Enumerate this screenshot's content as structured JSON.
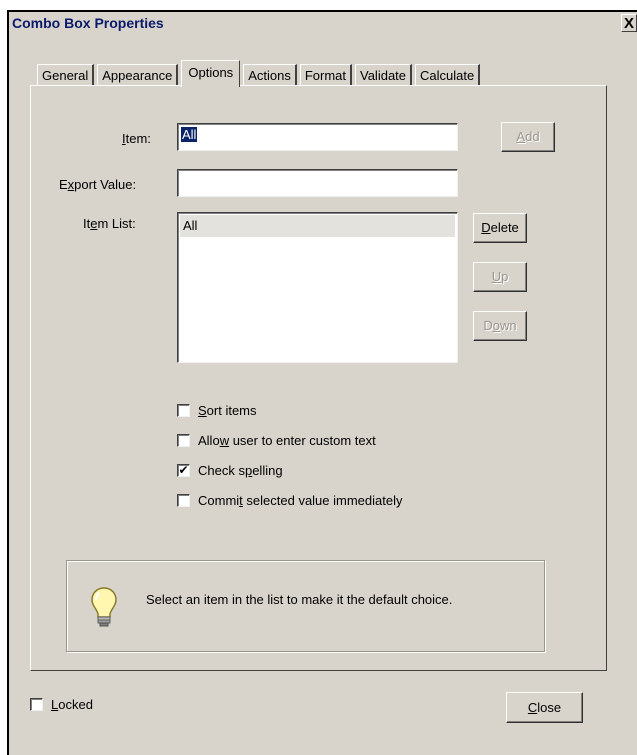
{
  "window": {
    "title": "Combo Box Properties",
    "close_glyph": "X"
  },
  "tabs": [
    {
      "label": "General"
    },
    {
      "label": "Appearance"
    },
    {
      "label": "Options",
      "active": true
    },
    {
      "label": "Actions"
    },
    {
      "label": "Format"
    },
    {
      "label": "Validate"
    },
    {
      "label": "Calculate"
    }
  ],
  "options": {
    "item": {
      "label_pre": "",
      "label_u": "I",
      "label_post": "tem:",
      "value": "All"
    },
    "export_value": {
      "label_pre": "E",
      "label_u": "x",
      "label_post": "port Value:",
      "value": ""
    },
    "item_list": {
      "label_pre": "It",
      "label_u": "e",
      "label_post": "m List:",
      "items": [
        "All"
      ]
    },
    "buttons": {
      "add": {
        "u": "A",
        "rest": "dd"
      },
      "delete": {
        "u": "D",
        "rest": "elete"
      },
      "up": {
        "u": "U",
        "rest": "p"
      },
      "down": {
        "pre": "D",
        "u": "o",
        "rest": "wn"
      }
    },
    "checkboxes": [
      {
        "pre": "",
        "u": "S",
        "post": "ort items",
        "checked": false
      },
      {
        "pre": "Allo",
        "u": "w",
        "post": " user to enter custom text",
        "checked": false
      },
      {
        "pre": "Check s",
        "u": "p",
        "post": "elling",
        "checked": true
      },
      {
        "pre": "Commi",
        "u": "t",
        "post": " selected value immediately",
        "checked": false
      }
    ],
    "info_text": "Select an item in the list to make it the default choice.",
    "check_glyph": "✔"
  },
  "footer": {
    "locked": {
      "u": "L",
      "rest": "ocked",
      "checked": false
    },
    "close": {
      "u": "C",
      "rest": "lose"
    }
  }
}
